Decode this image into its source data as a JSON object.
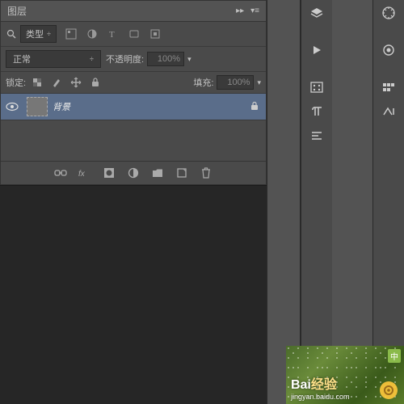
{
  "panel": {
    "title": "图层",
    "collapse": "▸▸",
    "menu": "▾≡"
  },
  "filter": {
    "kind_label": "类型",
    "chev": "÷"
  },
  "blend": {
    "mode": "正常",
    "opacity_label": "不透明度:",
    "opacity_value": "100%"
  },
  "lock": {
    "label": "锁定:",
    "fill_label": "填充:",
    "fill_value": "100%"
  },
  "layers": [
    {
      "name": "背景",
      "visible": true,
      "locked": true
    }
  ],
  "watermark": {
    "brand": "Bai",
    "brand2": "经验",
    "url": "jingyan.baidu.com",
    "badge": "中"
  }
}
